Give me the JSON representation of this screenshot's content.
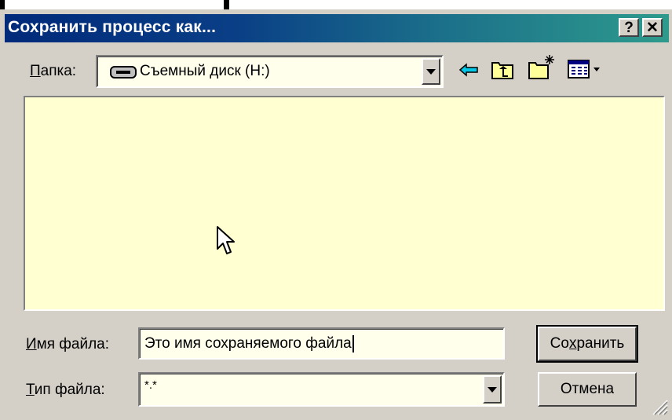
{
  "window": {
    "title": "Сохранить процесс как...",
    "help_label": "?",
    "close_label": "✕"
  },
  "folder_row": {
    "label_underlined": "П",
    "label_rest": "апка:",
    "value": "Съемный диск (H:)"
  },
  "filename_row": {
    "label_underlined": "И",
    "label_rest": "мя файла:",
    "value": "Это имя сохраняемого файла"
  },
  "filetype_row": {
    "label_underlined": "Т",
    "label_rest": "ип файла:",
    "value": "*.*"
  },
  "buttons": {
    "save_pre": "Со",
    "save_underlined": "х",
    "save_post": "ранить",
    "cancel": "Отмена"
  },
  "colors": {
    "dialog_bg": "#d4d0c8",
    "titlebar_start": "#002a7a",
    "titlebar_end": "#2e9a8c",
    "field_bg": "#ffffeb",
    "list_bg": "#ffffd2"
  }
}
